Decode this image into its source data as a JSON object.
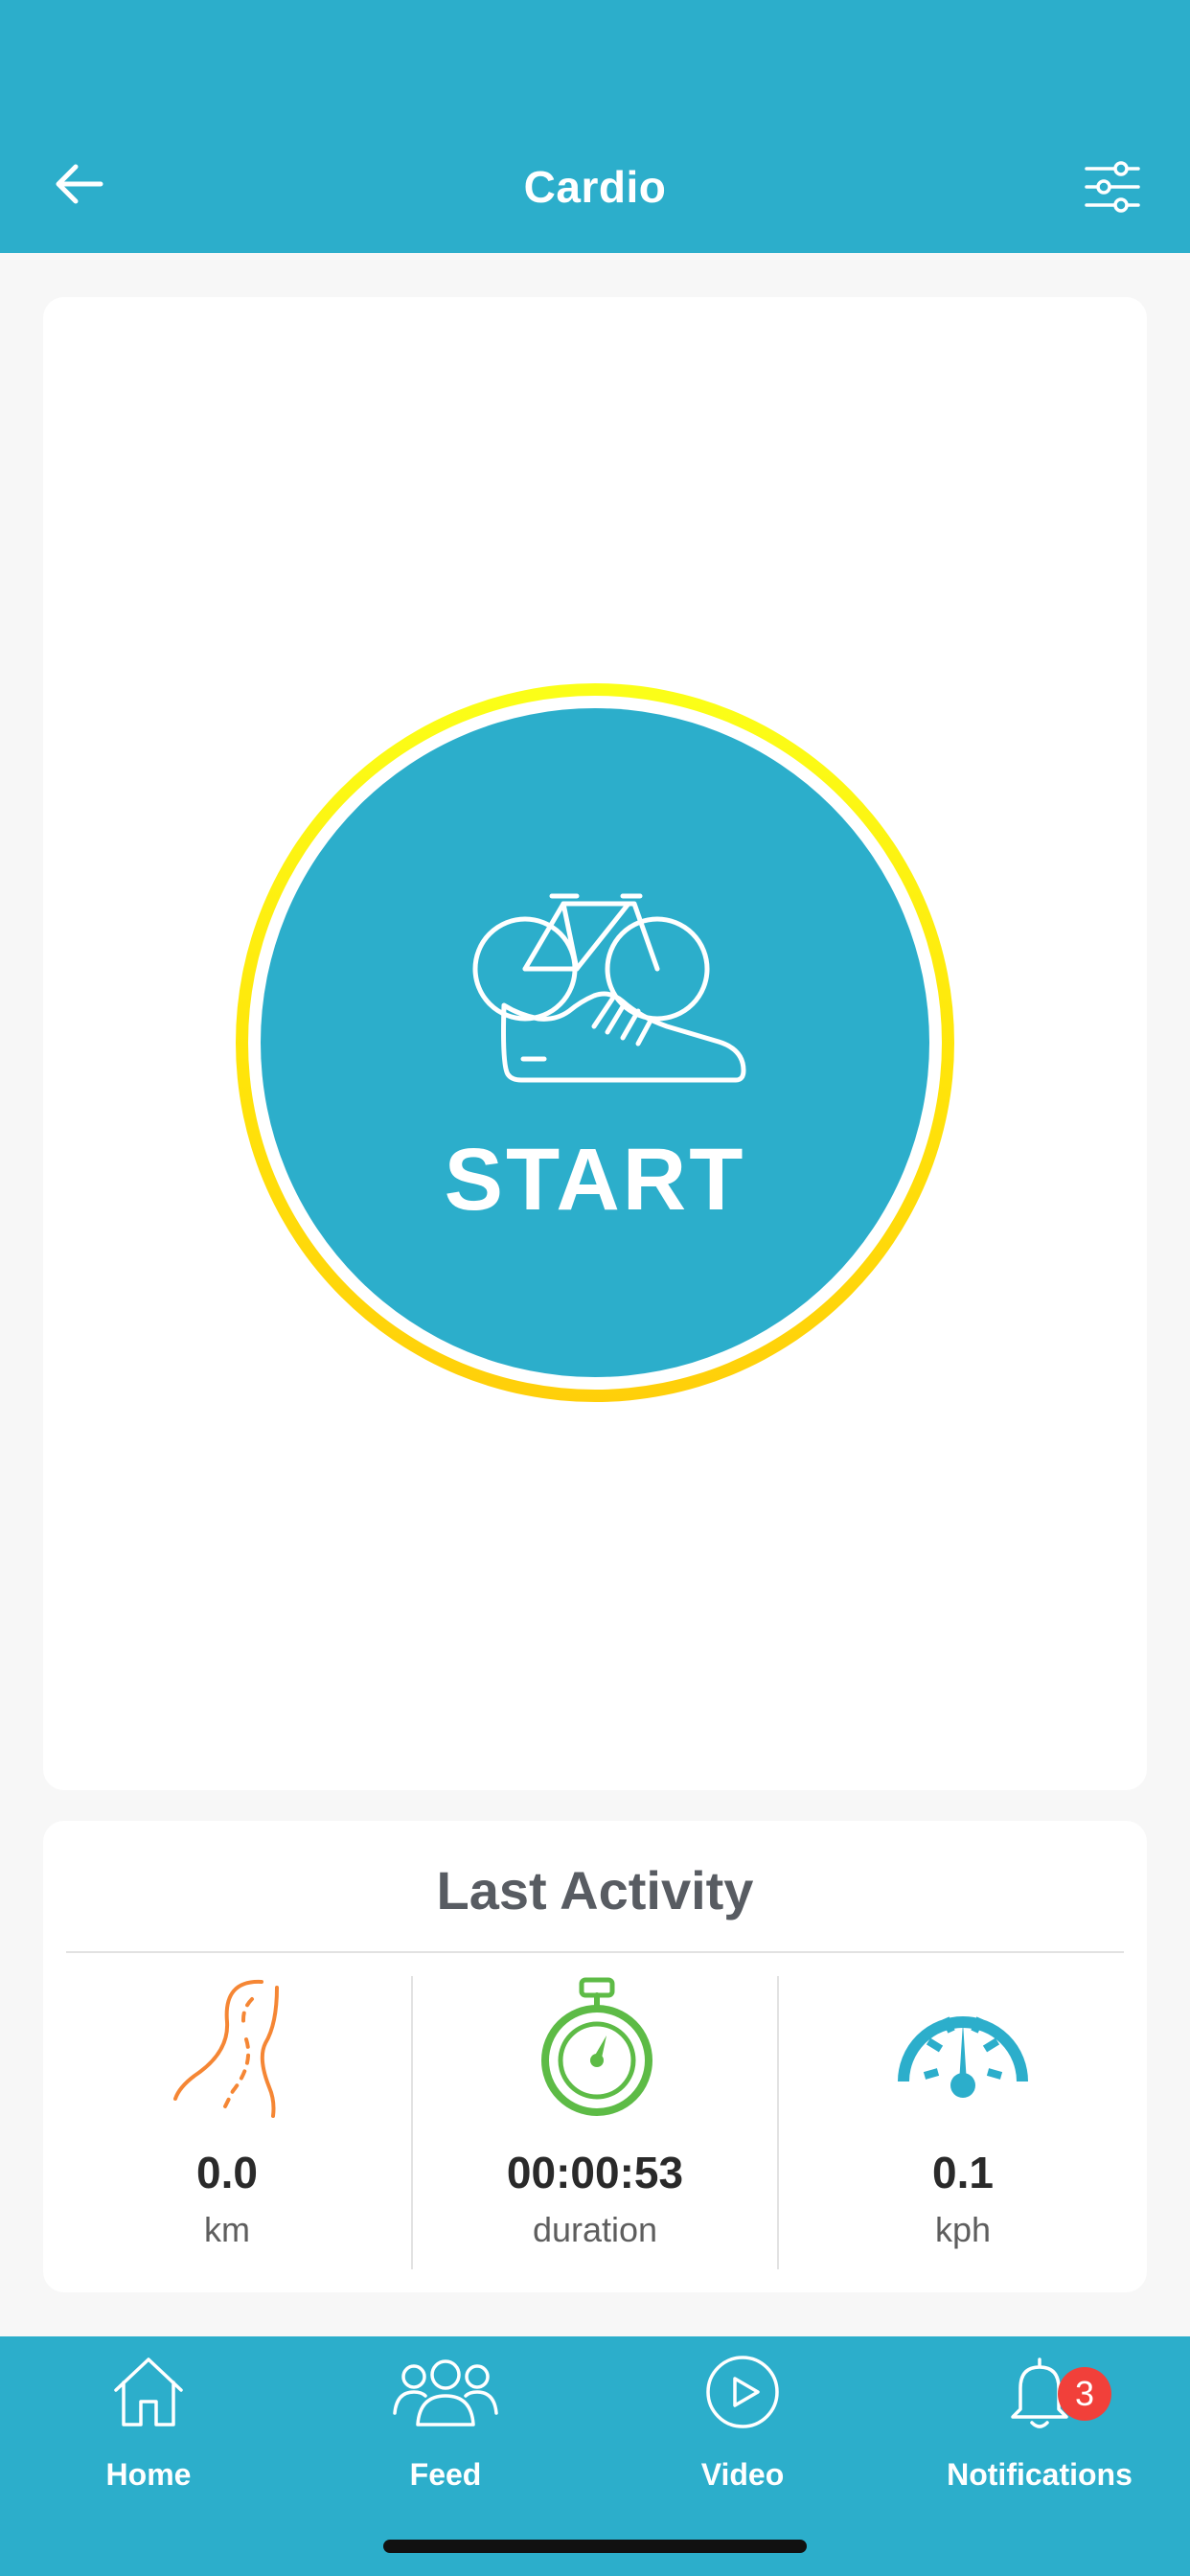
{
  "header": {
    "title": "Cardio",
    "back_icon": "arrow-left-icon",
    "filter_icon": "sliders-icon",
    "bg_color": "#2caecb"
  },
  "start_button": {
    "label": "START",
    "icon": "bike-and-shoe-icon",
    "fill_color": "#2caecb",
    "ring_color": "#ffe40a"
  },
  "last_activity": {
    "title": "Last Activity",
    "stats": [
      {
        "icon": "road-icon",
        "value": "0.0",
        "unit": "km",
        "color": "#f58634"
      },
      {
        "icon": "stopwatch-icon",
        "value": "00:00:53",
        "unit": "duration",
        "color": "#5dbb46"
      },
      {
        "icon": "speedometer-icon",
        "value": "0.1",
        "unit": "kph",
        "color": "#2caecb"
      }
    ]
  },
  "tabbar": {
    "tabs": [
      {
        "label": "Home",
        "icon": "home-icon"
      },
      {
        "label": "Feed",
        "icon": "people-icon"
      },
      {
        "label": "Video",
        "icon": "play-circle-icon"
      },
      {
        "label": "Notifications",
        "icon": "bell-icon",
        "badge": "3"
      }
    ],
    "badge_color": "#f1403a"
  }
}
